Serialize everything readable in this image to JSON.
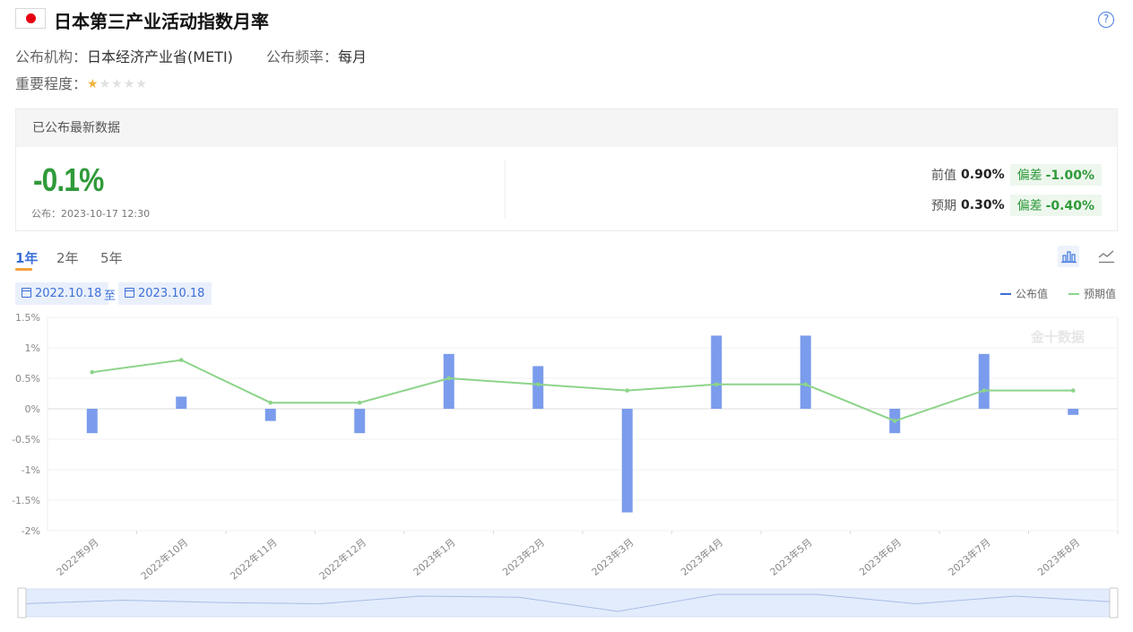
{
  "header": {
    "title": "日本第三产业活动指数月率",
    "help_label": "?",
    "source_label": "公布机构：",
    "source_value": "日本经济产业省(METI)",
    "freq_label": "公布频率：",
    "freq_value": "每月",
    "importance_label": "重要程度：",
    "importance_stars": 1,
    "importance_max": 5
  },
  "latest": {
    "panel_title": "已公布最新数据",
    "value": "-0.1%",
    "published": "公布：2023-10-17 12:30",
    "previous_label": "前值",
    "previous_value": "0.90%",
    "previous_dev_label": "偏差",
    "previous_dev_value": "-1.00%",
    "forecast_label": "预期",
    "forecast_value": "0.30%",
    "forecast_dev_label": "偏差",
    "forecast_dev_value": "-0.40%"
  },
  "tabs": [
    {
      "label": "1年",
      "active": true
    },
    {
      "label": "2年",
      "active": false
    },
    {
      "label": "5年",
      "active": false
    }
  ],
  "range": {
    "from": "2022.10.18",
    "sep": "至",
    "to": "2023.10.18"
  },
  "watermark": "金十数据",
  "colors": {
    "bar": "#7b9cec",
    "line": "#8dd48a",
    "accent": "#3b6fd8",
    "positive": "#2f9a3a"
  },
  "chart_data": {
    "type": "bar",
    "categories": [
      "2022年9月",
      "2022年10月",
      "2022年11月",
      "2022年12月",
      "2023年1月",
      "2023年2月",
      "2023年3月",
      "2023年4月",
      "2023年5月",
      "2023年6月",
      "2023年7月",
      "2023年8月"
    ],
    "series": [
      {
        "name": "公布值",
        "type": "bar",
        "values": [
          -0.4,
          0.2,
          -0.2,
          -0.4,
          0.9,
          0.7,
          -1.7,
          1.2,
          1.2,
          -0.4,
          0.9,
          -0.1
        ]
      },
      {
        "name": "预期值",
        "type": "line",
        "values": [
          0.6,
          0.8,
          0.1,
          0.1,
          0.5,
          0.4,
          0.3,
          0.4,
          0.4,
          -0.2,
          0.3,
          0.3
        ]
      }
    ],
    "y_ticks": [
      "1.5%",
      "1%",
      "0.5%",
      "0%",
      "-0.5%",
      "-1%",
      "-1.5%",
      "-2%"
    ],
    "ylim": [
      -2,
      1.5
    ],
    "grid": true,
    "legend": "top-right"
  }
}
